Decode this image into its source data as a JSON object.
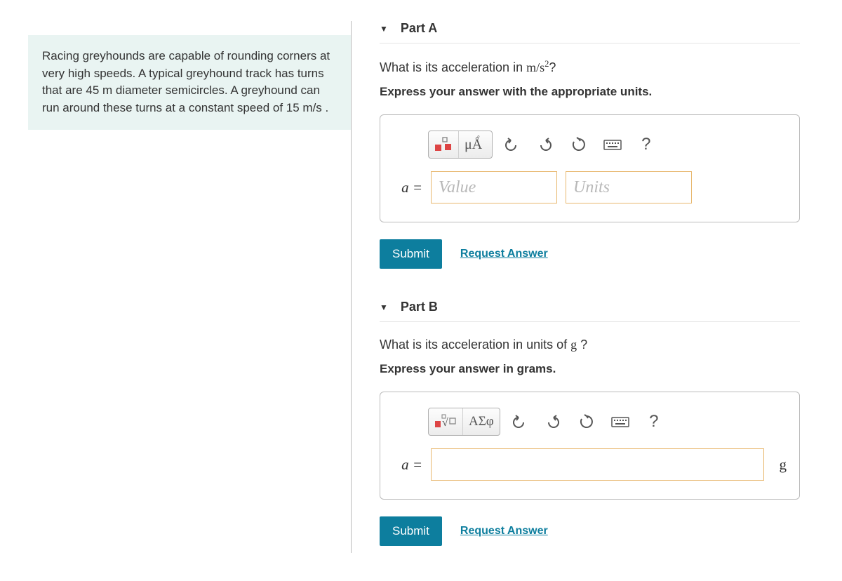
{
  "problem": {
    "text": "Racing greyhounds are capable of rounding corners at very high speeds. A typical greyhound track has turns that are 45  m diameter semicircles. A greyhound can run around these turns at a constant speed of 15  m/s ."
  },
  "partA": {
    "title": "Part A",
    "question_html": "What is its acceleration in <span class='mathspan'>m/s<span class='frac-sup'>2</span></span>?",
    "instruction": "Express your answer with the appropriate units.",
    "toolbar": {
      "units_btn": "μÅ",
      "help_btn": "?"
    },
    "var_label": "a =",
    "value_placeholder": "Value",
    "units_placeholder": "Units",
    "submit": "Submit",
    "request": "Request Answer"
  },
  "partB": {
    "title": "Part B",
    "question_html": "What is its acceleration in units of <span class='mathspan'>g</span> ?",
    "instruction": "Express your answer in grams.",
    "toolbar": {
      "greek_btn": "ΑΣφ",
      "help_btn": "?"
    },
    "var_label": "a =",
    "suffix_unit": "g",
    "submit": "Submit",
    "request": "Request Answer"
  }
}
